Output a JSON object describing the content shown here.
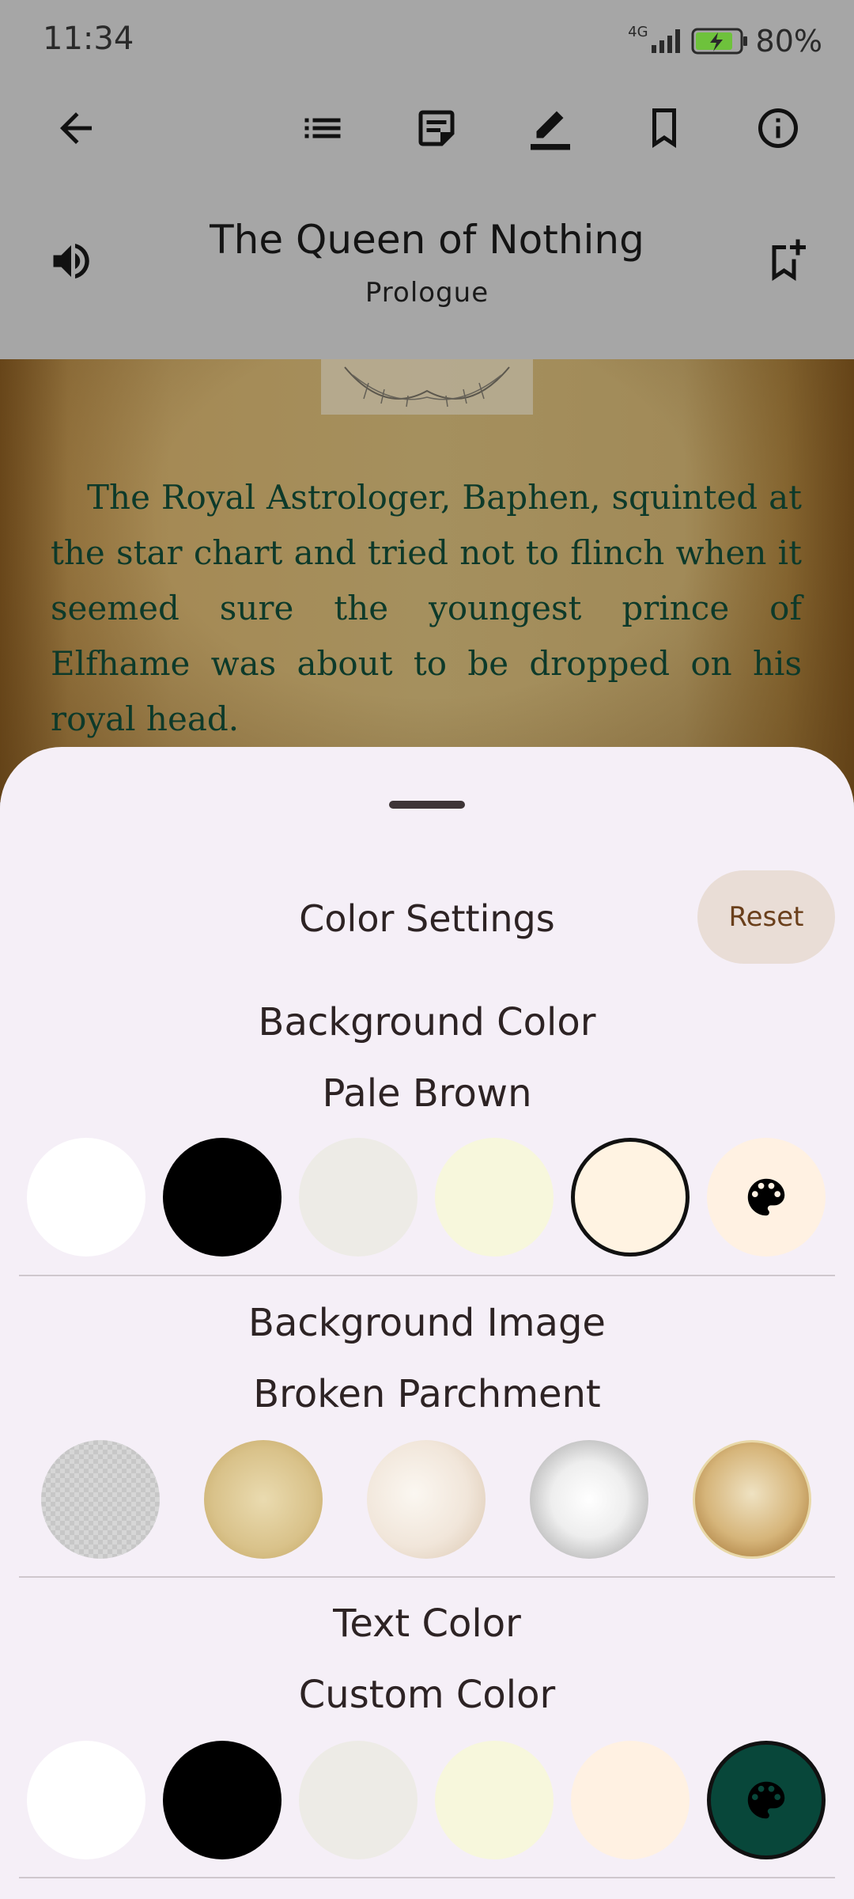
{
  "status_bar": {
    "time": "11:34",
    "network": "4G",
    "battery": "80%"
  },
  "toolbar": {
    "icons": [
      "back-arrow-icon",
      "table-of-contents-icon",
      "notes-icon",
      "highlight-pen-icon",
      "bookmark-icon",
      "info-icon",
      "speaker-icon",
      "add-bookmark-icon"
    ]
  },
  "book": {
    "title": "The Queen of Nothing",
    "chapter": "Prologue"
  },
  "reader": {
    "paragraph": "The Royal Astrologer, Baphen, squinted at the star chart and tried not to flinch when it seemed sure the youngest prince of Elfhame was about to be dropped on his royal head.",
    "text_color": "#0d3a2a"
  },
  "sheet": {
    "title": "Color Settings",
    "reset_label": "Reset",
    "background_color": {
      "label": "Background Color",
      "value": "Pale Brown",
      "swatches": [
        "#ffffff",
        "#000000",
        "#edebe6",
        "#f7f7dc",
        "#fff3e2"
      ],
      "selected_index": 4,
      "custom_swatch_color": "#fff1e2"
    },
    "background_image": {
      "label": "Background Image",
      "value": "Broken Parchment",
      "swatches": [
        "checker-texture",
        "aged-paper",
        "watercolor-paper",
        "halftone-vignette",
        "broken-parchment"
      ],
      "selected_index": 4
    },
    "text_color": {
      "label": "Text Color",
      "value": "Custom Color",
      "swatches": [
        "#ffffff",
        "#000000",
        "#edebe6",
        "#f7f7dc",
        "#fff1e2"
      ],
      "custom_swatch_color": "#08473a",
      "selected_custom": true
    }
  }
}
